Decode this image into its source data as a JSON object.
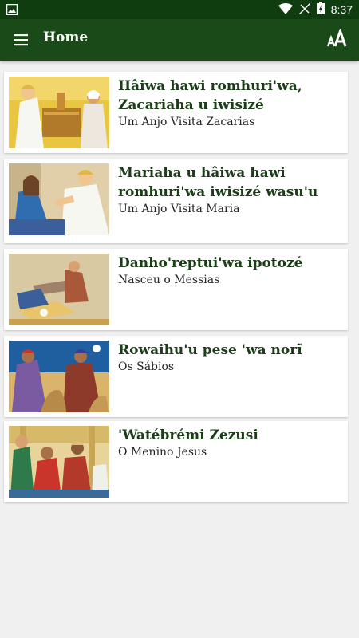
{
  "status_bar": {
    "time": "8:37",
    "icons": [
      "image-icon",
      "wifi-icon",
      "signal-icon",
      "battery-icon"
    ]
  },
  "app_bar": {
    "title": "Home",
    "menu_icon": "menu-icon",
    "font_size_icon": "font-size-icon"
  },
  "stories": [
    {
      "title": "Hâiwa hawi romhuri'wa, Zacariaha u iwisizé",
      "subtitle": "Um Anjo Visita Zacarias"
    },
    {
      "title": "Mariaha u hâiwa hawi romhuri'wa iwisizé wasu'u",
      "subtitle": "Um Anjo Visita Maria"
    },
    {
      "title": "Danho'reptui'wa ipotozé",
      "subtitle": "Nasceu o Messias"
    },
    {
      "title": "Rowaihu'u pese 'wa norĩ",
      "subtitle": "Os Sábios"
    },
    {
      "title": "'Watébrémi Zezusi",
      "subtitle": "O Menino Jesus"
    }
  ],
  "colors": {
    "status_bar": "#103d10",
    "app_bar": "#1b4a19",
    "title_text": "#1b3d18",
    "background": "#f0f0f0"
  }
}
